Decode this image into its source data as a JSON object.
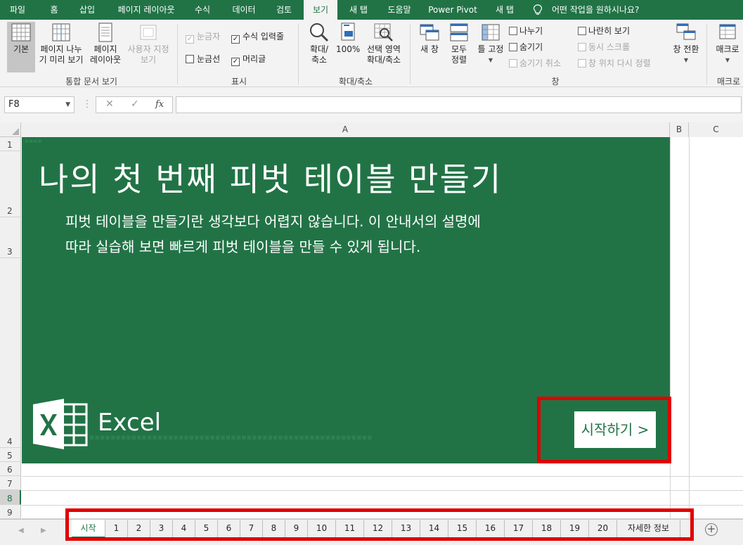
{
  "menu": {
    "tabs": [
      {
        "label": "파일"
      },
      {
        "label": "홈"
      },
      {
        "label": "삽입"
      },
      {
        "label": "페이지 레이아웃"
      },
      {
        "label": "수식"
      },
      {
        "label": "데이터"
      },
      {
        "label": "검토"
      },
      {
        "label": "보기"
      },
      {
        "label": "새 탭"
      },
      {
        "label": "도움말"
      },
      {
        "label": "Power Pivot"
      },
      {
        "label": "새 탭"
      }
    ],
    "active_tab": "보기",
    "tell_me": "어떤 작업을 원하시나요?"
  },
  "ribbon": {
    "workbook_views": {
      "normal": "기본",
      "page_break_l1": "페이지 나누",
      "page_break_l2": "기 미리 보기",
      "page_layout_l1": "페이지",
      "page_layout_l2": "레이아웃",
      "custom_l1": "사용자 지정",
      "custom_l2": "보기",
      "group_label": "통합 문서 보기"
    },
    "show": {
      "ruler": "눈금자",
      "formula_bar": "수식 입력줄",
      "gridlines": "눈금선",
      "headings": "머리글",
      "group_label": "표시"
    },
    "zoom": {
      "zoom_l1": "확대/",
      "zoom_l2": "축소",
      "hundred": "100%",
      "selection_l1": "선택 영역",
      "selection_l2": "확대/축소",
      "group_label": "확대/축소"
    },
    "window": {
      "new_window": "새 창",
      "arrange_l1": "모두",
      "arrange_l2": "정렬",
      "freeze": "틀 고정",
      "split": "나누기",
      "hide": "숨기기",
      "unhide": "숨기기 취소",
      "side_by_side": "나란히 보기",
      "sync_scroll": "동시 스크롤",
      "reset_pos": "창 위치 다시 정렬",
      "switch": "창 전환",
      "group_label": "창"
    },
    "macros": {
      "label": "매크로",
      "group_label": "매크로"
    }
  },
  "formula_bar": {
    "name_box": "F8",
    "fx": "fx",
    "value": ""
  },
  "grid": {
    "columns": [
      "A",
      "B",
      "C"
    ],
    "rows": [
      "1",
      "2",
      "3",
      "4",
      "5",
      "6",
      "7",
      "8",
      "9"
    ],
    "selected_row": "8"
  },
  "hero": {
    "title": "나의 첫 번째 피벗 테이블 만들기",
    "subtitle_l1": "피벗 테이블을 만들기란 생각보다 어렵지 않습니다. 이 안내서의 설명에",
    "subtitle_l2": "따라 실습해 보면 빠르게 피벗 테이블을 만들 수 있게 됩니다.",
    "logo_text": "Excel",
    "start_button": "시작하기 >",
    "colors": {
      "background": "#217346",
      "highlight": "#e00000"
    }
  },
  "sheets": {
    "tabs": [
      "시작",
      "1",
      "2",
      "3",
      "4",
      "5",
      "6",
      "7",
      "8",
      "9",
      "10",
      "11",
      "12",
      "13",
      "14",
      "15",
      "16",
      "17",
      "18",
      "19",
      "20",
      "자세한 정보"
    ],
    "active": "시작",
    "add_symbol": "+"
  }
}
